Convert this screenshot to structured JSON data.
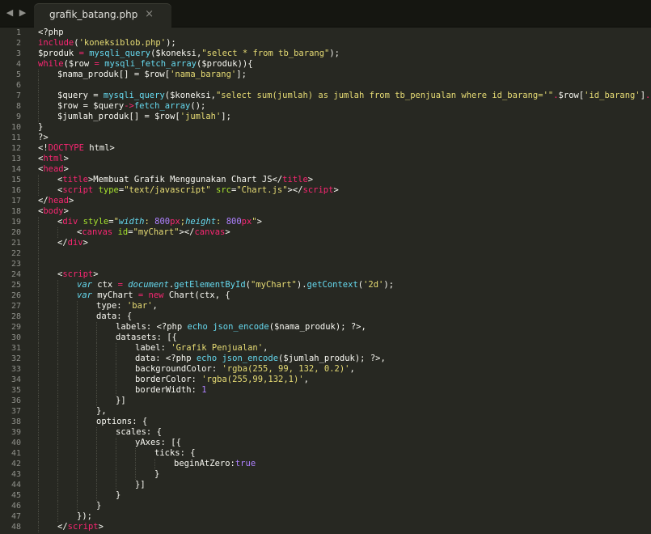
{
  "window": {
    "nav_back": "◀",
    "nav_forward": "▶"
  },
  "tab": {
    "title": "grafik_batang.php",
    "close": "×"
  },
  "editor": {
    "theme": {
      "background": "#272822",
      "keyword": "#f92672",
      "string": "#e6db74",
      "function": "#66d9ef",
      "attribute": "#a6e22e",
      "number": "#ae81ff"
    },
    "lines": [
      {
        "n": "1",
        "indent": 0,
        "tokens": [
          [
            "ph",
            "<?php"
          ]
        ]
      },
      {
        "n": "2",
        "indent": 0,
        "tokens": [
          [
            "kw",
            "include"
          ],
          [
            "ph",
            "("
          ],
          [
            "st",
            "'koneksiblob.php'"
          ],
          [
            "ph",
            ");"
          ]
        ]
      },
      {
        "n": "3",
        "indent": 0,
        "tokens": [
          [
            "vr",
            "$produk"
          ],
          [
            "kw",
            " = "
          ],
          [
            "fn",
            "mysqli_query"
          ],
          [
            "ph",
            "($koneksi,"
          ],
          [
            "st",
            "\"select * from tb_barang\""
          ],
          [
            "ph",
            ");"
          ]
        ]
      },
      {
        "n": "4",
        "indent": 0,
        "tokens": [
          [
            "kw",
            "while"
          ],
          [
            "ph",
            "($row "
          ],
          [
            "kw",
            "="
          ],
          [
            "ph",
            " "
          ],
          [
            "fn",
            "mysqli_fetch_array"
          ],
          [
            "ph",
            "($produk)){"
          ]
        ]
      },
      {
        "n": "5",
        "indent": 1,
        "tokens": [
          [
            "vr",
            "$nama_produk[] = $row["
          ],
          [
            "st",
            "'nama_barang'"
          ],
          [
            "ph",
            "];"
          ]
        ]
      },
      {
        "n": "6",
        "indent": 1,
        "tokens": []
      },
      {
        "n": "7",
        "indent": 1,
        "tokens": [
          [
            "vr",
            "$query = "
          ],
          [
            "fn",
            "mysqli_query"
          ],
          [
            "ph",
            "($koneksi,"
          ],
          [
            "st",
            "\"select sum(jumlah) as jumlah from tb_penjualan where id_barang='\""
          ],
          [
            "kw",
            "."
          ],
          [
            "ph",
            "$row["
          ],
          [
            "st",
            "'id_barang'"
          ],
          [
            "ph",
            "]"
          ],
          [
            "kw",
            "."
          ],
          [
            "st",
            "\"'\""
          ],
          [
            "ph",
            ");"
          ]
        ]
      },
      {
        "n": "8",
        "indent": 1,
        "tokens": [
          [
            "vr",
            "$row = $query"
          ],
          [
            "kw",
            "->"
          ],
          [
            "fn",
            "fetch_array"
          ],
          [
            "ph",
            "();"
          ]
        ]
      },
      {
        "n": "9",
        "indent": 1,
        "tokens": [
          [
            "vr",
            "$jumlah_produk[] = $row["
          ],
          [
            "st",
            "'jumlah'"
          ],
          [
            "ph",
            "];"
          ]
        ]
      },
      {
        "n": "10",
        "indent": 0,
        "tokens": [
          [
            "ph",
            "}"
          ]
        ]
      },
      {
        "n": "11",
        "indent": 0,
        "tokens": [
          [
            "ph",
            "?>"
          ]
        ]
      },
      {
        "n": "12",
        "indent": 0,
        "tokens": [
          [
            "ph",
            "<!"
          ],
          [
            "tg",
            "DOCTYPE"
          ],
          [
            "ph",
            " html>"
          ]
        ]
      },
      {
        "n": "13",
        "indent": 0,
        "tokens": [
          [
            "ph",
            "<"
          ],
          [
            "tg",
            "html"
          ],
          [
            "ph",
            ">"
          ]
        ]
      },
      {
        "n": "14",
        "indent": 0,
        "tokens": [
          [
            "ph",
            "<"
          ],
          [
            "tg",
            "head"
          ],
          [
            "ph",
            ">"
          ]
        ]
      },
      {
        "n": "15",
        "indent": 1,
        "tokens": [
          [
            "ph",
            "<"
          ],
          [
            "tg",
            "title"
          ],
          [
            "ph",
            ">Membuat Grafik Menggunakan Chart JS</"
          ],
          [
            "tg",
            "title"
          ],
          [
            "ph",
            ">"
          ]
        ]
      },
      {
        "n": "16",
        "indent": 1,
        "tokens": [
          [
            "ph",
            "<"
          ],
          [
            "tg",
            "script"
          ],
          [
            "ph",
            " "
          ],
          [
            "at",
            "type"
          ],
          [
            "ph",
            "="
          ],
          [
            "st",
            "\"text/javascript\""
          ],
          [
            "ph",
            " "
          ],
          [
            "at",
            "src"
          ],
          [
            "ph",
            "="
          ],
          [
            "st",
            "\"Chart.js\""
          ],
          [
            "ph",
            "></"
          ],
          [
            "tg",
            "script"
          ],
          [
            "ph",
            ">"
          ]
        ]
      },
      {
        "n": "17",
        "indent": 0,
        "tokens": [
          [
            "ph",
            "</"
          ],
          [
            "tg",
            "head"
          ],
          [
            "ph",
            ">"
          ]
        ]
      },
      {
        "n": "18",
        "indent": 0,
        "tokens": [
          [
            "ph",
            "<"
          ],
          [
            "tg",
            "body"
          ],
          [
            "ph",
            ">"
          ]
        ]
      },
      {
        "n": "19",
        "indent": 1,
        "tokens": [
          [
            "ph",
            "<"
          ],
          [
            "tg",
            "div"
          ],
          [
            "ph",
            " "
          ],
          [
            "at",
            "style"
          ],
          [
            "ph",
            "="
          ],
          [
            "st",
            "\""
          ],
          [
            "sk",
            "width"
          ],
          [
            "st",
            ": "
          ],
          [
            "nu",
            "800"
          ],
          [
            "kw",
            "px"
          ],
          [
            "st",
            ";"
          ],
          [
            "sk",
            "height"
          ],
          [
            "st",
            ": "
          ],
          [
            "nu",
            "800"
          ],
          [
            "kw",
            "px"
          ],
          [
            "st",
            "\""
          ],
          [
            "ph",
            ">"
          ]
        ]
      },
      {
        "n": "20",
        "indent": 2,
        "tokens": [
          [
            "ph",
            "<"
          ],
          [
            "tg",
            "canvas"
          ],
          [
            "ph",
            " "
          ],
          [
            "at",
            "id"
          ],
          [
            "ph",
            "="
          ],
          [
            "st",
            "\"myChart\""
          ],
          [
            "ph",
            "></"
          ],
          [
            "tg",
            "canvas"
          ],
          [
            "ph",
            ">"
          ]
        ]
      },
      {
        "n": "21",
        "indent": 1,
        "tokens": [
          [
            "ph",
            "</"
          ],
          [
            "tg",
            "div"
          ],
          [
            "ph",
            ">"
          ]
        ]
      },
      {
        "n": "22",
        "indent": 1,
        "tokens": []
      },
      {
        "n": "23",
        "indent": 1,
        "tokens": []
      },
      {
        "n": "24",
        "indent": 1,
        "tokens": [
          [
            "ph",
            "<"
          ],
          [
            "tg",
            "script"
          ],
          [
            "ph",
            ">"
          ]
        ]
      },
      {
        "n": "25",
        "indent": 2,
        "tokens": [
          [
            "sk",
            "var"
          ],
          [
            "ph",
            " ctx "
          ],
          [
            "kw",
            "="
          ],
          [
            "ph",
            " "
          ],
          [
            "sk",
            "document"
          ],
          [
            "ph",
            "."
          ],
          [
            "fn",
            "getElementById"
          ],
          [
            "ph",
            "("
          ],
          [
            "st",
            "\"myChart\""
          ],
          [
            "ph",
            ")."
          ],
          [
            "fn",
            "getContext"
          ],
          [
            "ph",
            "("
          ],
          [
            "st",
            "'2d'"
          ],
          [
            "ph",
            ");"
          ]
        ]
      },
      {
        "n": "26",
        "indent": 2,
        "tokens": [
          [
            "sk",
            "var"
          ],
          [
            "ph",
            " myChart "
          ],
          [
            "kw",
            "="
          ],
          [
            "ph",
            " "
          ],
          [
            "kw",
            "new"
          ],
          [
            "ph",
            " Chart(ctx, {"
          ]
        ]
      },
      {
        "n": "27",
        "indent": 3,
        "tokens": [
          [
            "ph",
            "type: "
          ],
          [
            "st",
            "'bar'"
          ],
          [
            "ph",
            ","
          ]
        ]
      },
      {
        "n": "28",
        "indent": 3,
        "tokens": [
          [
            "ph",
            "data: {"
          ]
        ]
      },
      {
        "n": "29",
        "indent": 4,
        "tokens": [
          [
            "ph",
            "labels: <?php "
          ],
          [
            "fn",
            "echo"
          ],
          [
            "ph",
            " "
          ],
          [
            "fn",
            "json_encode"
          ],
          [
            "ph",
            "($nama_produk); ?>,"
          ]
        ]
      },
      {
        "n": "30",
        "indent": 4,
        "tokens": [
          [
            "ph",
            "datasets: [{"
          ]
        ]
      },
      {
        "n": "31",
        "indent": 5,
        "tokens": [
          [
            "ph",
            "label: "
          ],
          [
            "st",
            "'Grafik Penjualan'"
          ],
          [
            "ph",
            ","
          ]
        ]
      },
      {
        "n": "32",
        "indent": 5,
        "tokens": [
          [
            "ph",
            "data: <?php "
          ],
          [
            "fn",
            "echo"
          ],
          [
            "ph",
            " "
          ],
          [
            "fn",
            "json_encode"
          ],
          [
            "ph",
            "($jumlah_produk); ?>,"
          ]
        ]
      },
      {
        "n": "33",
        "indent": 5,
        "tokens": [
          [
            "ph",
            "backgroundColor: "
          ],
          [
            "st",
            "'rgba(255, 99, 132, 0.2)'"
          ],
          [
            "ph",
            ","
          ]
        ]
      },
      {
        "n": "34",
        "indent": 5,
        "tokens": [
          [
            "ph",
            "borderColor: "
          ],
          [
            "st",
            "'rgba(255,99,132,1)'"
          ],
          [
            "ph",
            ","
          ]
        ]
      },
      {
        "n": "35",
        "indent": 5,
        "tokens": [
          [
            "ph",
            "borderWidth: "
          ],
          [
            "nu",
            "1"
          ]
        ]
      },
      {
        "n": "36",
        "indent": 4,
        "tokens": [
          [
            "ph",
            "}]"
          ]
        ]
      },
      {
        "n": "37",
        "indent": 3,
        "tokens": [
          [
            "ph",
            "},"
          ]
        ]
      },
      {
        "n": "38",
        "indent": 3,
        "tokens": [
          [
            "ph",
            "options: {"
          ]
        ]
      },
      {
        "n": "39",
        "indent": 4,
        "tokens": [
          [
            "ph",
            "scales: {"
          ]
        ]
      },
      {
        "n": "40",
        "indent": 5,
        "tokens": [
          [
            "ph",
            "yAxes: [{"
          ]
        ]
      },
      {
        "n": "41",
        "indent": 6,
        "tokens": [
          [
            "ph",
            "ticks: {"
          ]
        ]
      },
      {
        "n": "42",
        "indent": 7,
        "tokens": [
          [
            "ph",
            "beginAtZero:"
          ],
          [
            "nu",
            "true"
          ]
        ]
      },
      {
        "n": "43",
        "indent": 6,
        "tokens": [
          [
            "ph",
            "}"
          ]
        ]
      },
      {
        "n": "44",
        "indent": 5,
        "tokens": [
          [
            "ph",
            "}]"
          ]
        ]
      },
      {
        "n": "45",
        "indent": 4,
        "tokens": [
          [
            "ph",
            "}"
          ]
        ]
      },
      {
        "n": "46",
        "indent": 3,
        "tokens": [
          [
            "ph",
            "}"
          ]
        ]
      },
      {
        "n": "47",
        "indent": 2,
        "tokens": [
          [
            "ph",
            "});"
          ]
        ]
      },
      {
        "n": "48",
        "indent": 1,
        "tokens": [
          [
            "ph",
            "</"
          ],
          [
            "tg",
            "script"
          ],
          [
            "ph",
            ">"
          ]
        ]
      }
    ]
  }
}
